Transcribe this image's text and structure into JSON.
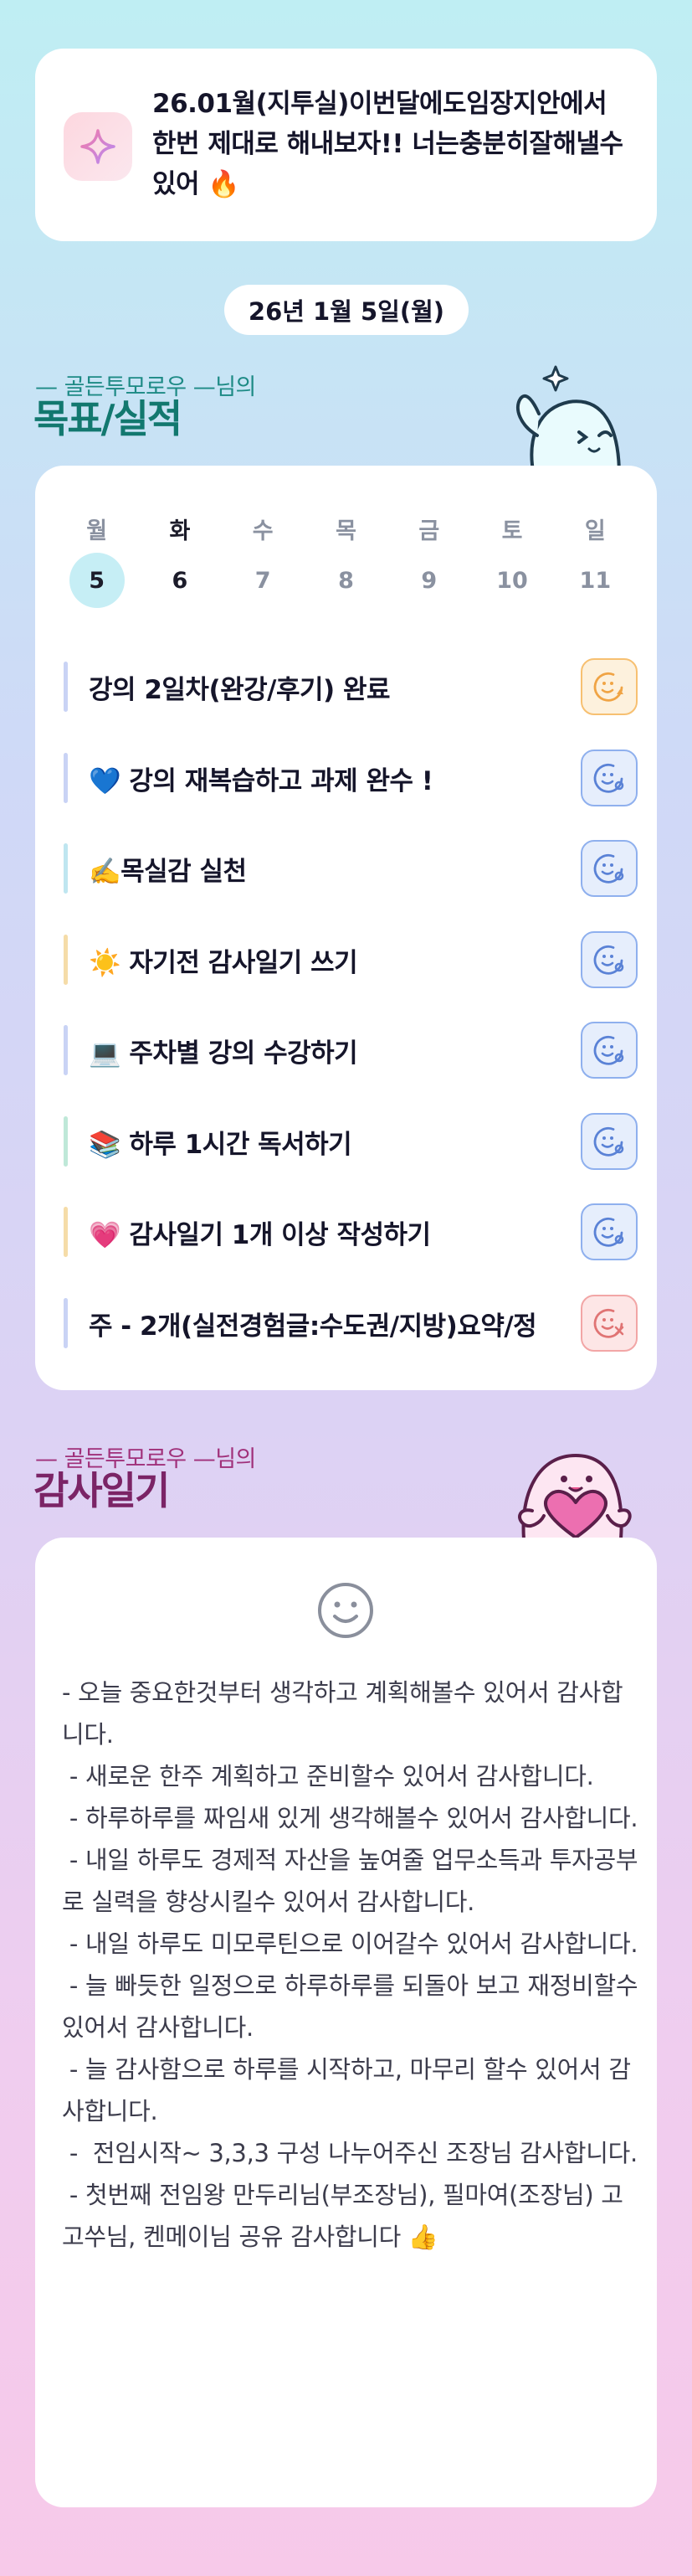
{
  "motto": {
    "text": "26.01월(지투실)이번달에도임장지안에서 한번 제대로 해내보자!! 너는충분히잘해낼수있어 🔥",
    "icon": "sparkle-icon"
  },
  "date_label": "26년 1월 5일(월)",
  "goals_section": {
    "subtitle": "— 골든투모로우 —님의",
    "title": "목표/실적"
  },
  "calendar": {
    "weekdays": [
      "월",
      "화",
      "수",
      "목",
      "금",
      "토",
      "일"
    ],
    "dates": [
      "5",
      "6",
      "7",
      "8",
      "9",
      "10",
      "11"
    ],
    "selected_index": 0
  },
  "tasks": [
    {
      "label": "강의 2일차(완강/후기) 완료",
      "bar_color": "#c9d3f5",
      "status": "done",
      "status_icon": "done-face-icon"
    },
    {
      "label": "💙 강의 재복습하고 과제 완수 !",
      "bar_color": "#c9d3f5",
      "status": "check",
      "status_icon": "check-face-icon"
    },
    {
      "label": "✍️목실감 실천",
      "bar_color": "#bfe6f0",
      "status": "check",
      "status_icon": "check-face-icon"
    },
    {
      "label": "☀️ 자기전 감사일기 쓰기",
      "bar_color": "#f5dca8",
      "status": "check",
      "status_icon": "check-face-icon"
    },
    {
      "label": "💻 주차별 강의 수강하기",
      "bar_color": "#c9d3f5",
      "status": "check",
      "status_icon": "check-face-icon"
    },
    {
      "label": "📚 하루 1시간 독서하기",
      "bar_color": "#bfe8d8",
      "status": "check",
      "status_icon": "check-face-icon"
    },
    {
      "label": "💗 감사일기 1개 이상 작성하기",
      "bar_color": "#f5dca8",
      "status": "check",
      "status_icon": "check-face-icon"
    },
    {
      "label": "주 - 2개(실전경험글:수도권/지방)요약/정",
      "bar_color": "#c9d3f5",
      "status": "fail",
      "status_icon": "fail-face-icon"
    }
  ],
  "diary_section": {
    "subtitle": "— 골든투모로우 —님의",
    "title": "감사일기",
    "face_icon": "smiley-icon",
    "text": "- 오늘 중요한것부터 생각하고 계획해볼수 있어서 감사합니다.\n - 새로운 한주 계획하고 준비할수 있어서 감사합니다.\n - 하루하루를 짜임새 있게 생각해볼수 있어서 감사합니다.\n - 내일 하루도 경제적 자산을 높여줄 업무소득과 투자공부로 실력을 향상시킬수 있어서 감사합니다.\n - 내일 하루도 미모루틴으로 이어갈수 있어서 감사합니다.\n - 늘 빠듯한 일정으로 하루하루를 되돌아 보고 재정비할수 있어서 감사합니다.\n - 늘 감사함으로 하루를 시작하고, 마무리 할수 있어서 감사합니다.\n -  전임시작~ 3,3,3 구성 나누어주신 조장님 감사합니다.\n - 첫번째 전임왕 만두리님(부조장님), 필마여(조장님) 고고쑤님, 켄메이님 공유 감사합니다 👍"
  },
  "colors": {
    "accent_teal": "#12786f",
    "accent_plum": "#7b2466",
    "selected_day": "#c6eef5"
  }
}
